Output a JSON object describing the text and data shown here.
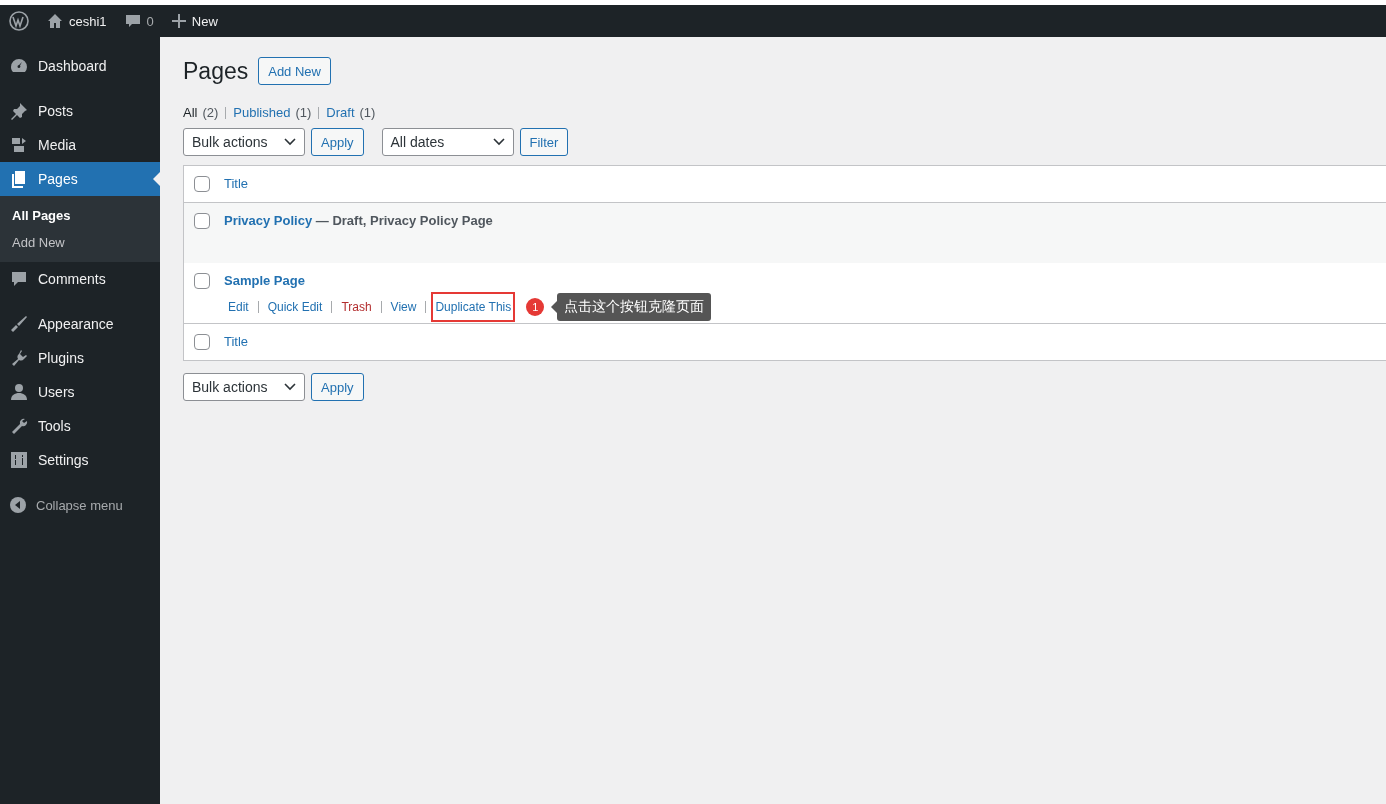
{
  "admin_bar": {
    "site": "ceshi1",
    "comments": "0",
    "new_label": "New"
  },
  "sidebar": {
    "groups": [
      [
        {
          "label": "Dashboard",
          "kind": "dashboard",
          "selected": false
        }
      ],
      [
        {
          "label": "Posts",
          "kind": "pin",
          "selected": false
        },
        {
          "label": "Media",
          "kind": "media",
          "selected": false
        },
        {
          "label": "Pages",
          "kind": "pages",
          "selected": true,
          "children": [
            {
              "label": "All Pages",
              "selected": true
            },
            {
              "label": "Add New",
              "selected": false
            }
          ]
        },
        {
          "label": "Comments",
          "kind": "comment",
          "selected": false
        }
      ],
      [
        {
          "label": "Appearance",
          "kind": "brush",
          "selected": false
        },
        {
          "label": "Plugins",
          "kind": "plug",
          "selected": false
        },
        {
          "label": "Users",
          "kind": "user",
          "selected": false
        },
        {
          "label": "Tools",
          "kind": "wrench",
          "selected": false
        },
        {
          "label": "Settings",
          "kind": "sliders",
          "selected": false
        }
      ]
    ],
    "collapse": "Collapse menu"
  },
  "page_title": "Pages",
  "add_new": "Add New",
  "filters": [
    {
      "label": "All",
      "count": "(2)",
      "selected": true
    },
    {
      "label": "Published",
      "count": "(1)",
      "selected": false
    },
    {
      "label": "Draft",
      "count": "(1)",
      "selected": false
    }
  ],
  "top_actions": {
    "bulk": "Bulk actions",
    "apply": "Apply",
    "dates": "All dates",
    "filter": "Filter"
  },
  "table": {
    "column": "Title",
    "header_checked": false,
    "footer_column": "Title",
    "footer_checked": false,
    "rows": [
      {
        "title": "Privacy Policy",
        "state": "— Draft, Privacy Policy Page",
        "checked": false,
        "actions": []
      },
      {
        "title": "Sample Page",
        "checked": false,
        "actions": [
          {
            "label": "Edit",
            "kind": "normal",
            "annotated": false
          },
          {
            "label": "Quick Edit",
            "kind": "normal",
            "annotated": false
          },
          {
            "label": "Trash",
            "kind": "delete",
            "annotated": false
          },
          {
            "label": "View",
            "kind": "normal",
            "annotated": false
          },
          {
            "label": "Duplicate This",
            "kind": "normal",
            "annotated": true
          }
        ]
      }
    ]
  },
  "annotation": {
    "number": "1",
    "text": "点击这个按钮克隆页面"
  },
  "bottom_actions": {
    "bulk": "Bulk actions",
    "apply": "Apply"
  }
}
